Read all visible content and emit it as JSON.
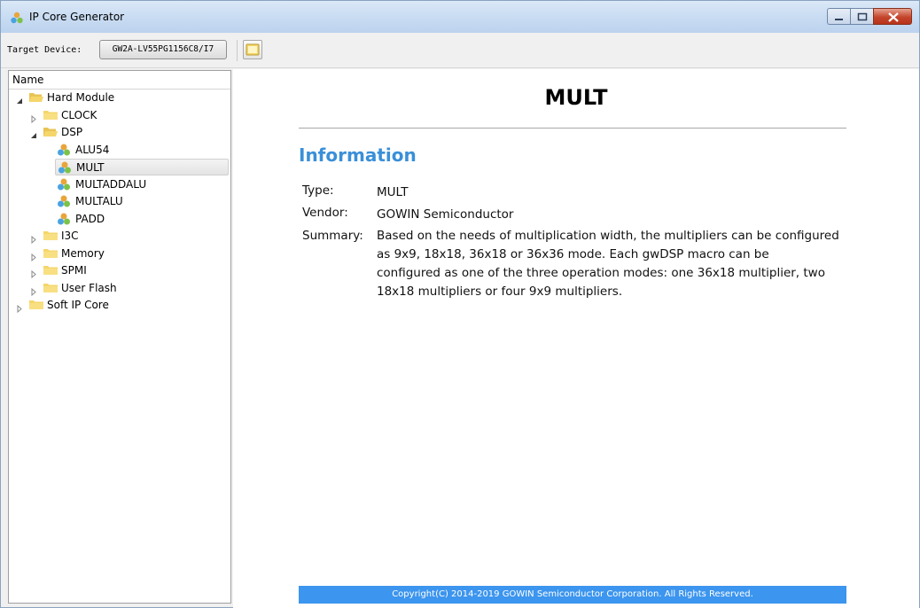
{
  "window": {
    "title": "IP Core Generator",
    "buttons": [
      "minimize",
      "maximize",
      "close"
    ]
  },
  "toolbar": {
    "target_label": "Target Device:",
    "device_value": "GW2A-LV55PG1156C8/I7"
  },
  "tree": {
    "header": "Name",
    "items": [
      {
        "label": "Hard Module",
        "level": 0,
        "expanded": true,
        "type": "folder-open"
      },
      {
        "label": "CLOCK",
        "level": 1,
        "expanded": false,
        "type": "folder"
      },
      {
        "label": "DSP",
        "level": 1,
        "expanded": true,
        "type": "folder-open"
      },
      {
        "label": "ALU54",
        "level": 2,
        "type": "ip"
      },
      {
        "label": "MULT",
        "level": 2,
        "type": "ip",
        "selected": true
      },
      {
        "label": "MULTADDALU",
        "level": 2,
        "type": "ip"
      },
      {
        "label": "MULTALU",
        "level": 2,
        "type": "ip"
      },
      {
        "label": "PADD",
        "level": 2,
        "type": "ip"
      },
      {
        "label": "I3C",
        "level": 1,
        "expanded": false,
        "type": "folder"
      },
      {
        "label": "Memory",
        "level": 1,
        "expanded": false,
        "type": "folder"
      },
      {
        "label": "SPMI",
        "level": 1,
        "expanded": false,
        "type": "folder"
      },
      {
        "label": "User Flash",
        "level": 1,
        "expanded": false,
        "type": "folder"
      },
      {
        "label": "Soft IP Core",
        "level": 0,
        "expanded": false,
        "type": "folder"
      }
    ]
  },
  "content": {
    "title": "MULT",
    "heading": "Information",
    "type_key": "Type:",
    "type_val": "MULT",
    "vendor_key": "Vendor:",
    "vendor_val": "GOWIN Semiconductor",
    "summary_key": "Summary:",
    "summary_lines": [
      "Based on the needs of multiplication width, the multipliers can be configured",
      "as 9x9, 18x18, 36x18 or 36x36 mode. Each gwDSP macro can be",
      "configured as one of the three operation modes: one 36x18 multiplier, two",
      "18x18 multipliers or four 9x9 multipliers."
    ],
    "footer": "Copyright(C) 2014-2019 GOWIN Semiconductor Corporation. All Rights Reserved."
  },
  "colors": {
    "heading": "#3a8fd8",
    "footer_bg": "#3c95ee",
    "folder": "#f5d66a"
  }
}
